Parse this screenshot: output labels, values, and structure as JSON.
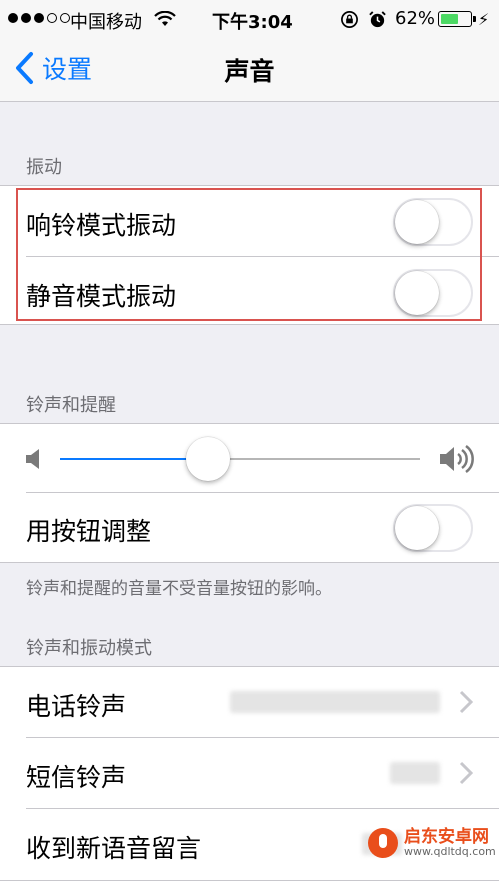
{
  "status_bar": {
    "signal_dots_filled": 3,
    "signal_dots_total": 5,
    "carrier": "中国移动",
    "time": "下午3:04",
    "battery_percent_text": "62%",
    "battery_level": 0.62,
    "battery_color": "#4cd964"
  },
  "nav": {
    "back_label": "设置",
    "title": "声音",
    "accent": "#0a7aff"
  },
  "vibrate_section": {
    "header": "振动",
    "rows": [
      {
        "label": "响铃模式振动",
        "on": false
      },
      {
        "label": "静音模式振动",
        "on": false
      }
    ],
    "highlight_color": "#d9534f"
  },
  "ringer_section": {
    "header": "铃声和提醒",
    "volume_level": 0.41,
    "adjust_label": "用按钮调整",
    "adjust_on": false,
    "footer": "铃声和提醒的音量不受音量按钮的影响。"
  },
  "patterns_section": {
    "header": "铃声和振动模式",
    "rows": [
      {
        "label": "电话铃声"
      },
      {
        "label": "短信铃声"
      },
      {
        "label": "收到新语音留言"
      }
    ]
  },
  "watermark": {
    "title": "启东安卓网",
    "url": "www.qdltdq.com"
  }
}
